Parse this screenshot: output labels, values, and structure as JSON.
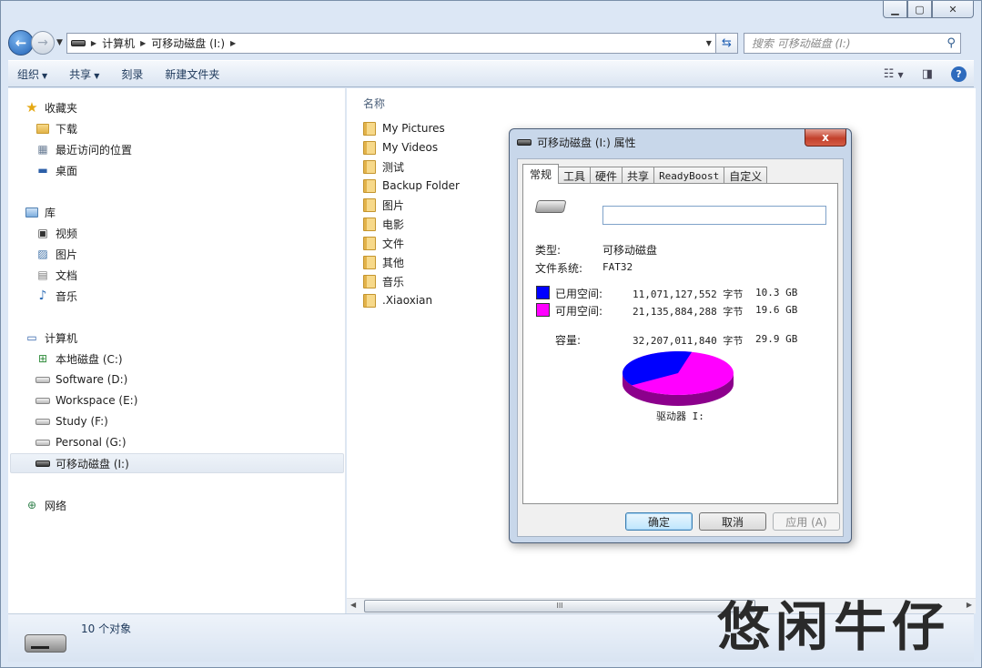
{
  "address": {
    "crumbs": [
      "计算机",
      "可移动磁盘 (I:)"
    ]
  },
  "search": {
    "placeholder": "搜索 可移动磁盘 (I:)"
  },
  "toolbar": {
    "organize": "组织",
    "share": "共享",
    "burn": "刻录",
    "new_folder": "新建文件夹"
  },
  "sidebar": {
    "favorites": {
      "label": "收藏夹",
      "items": [
        "下载",
        "最近访问的位置",
        "桌面"
      ]
    },
    "libraries": {
      "label": "库",
      "items": [
        "视频",
        "图片",
        "文档",
        "音乐"
      ]
    },
    "computer": {
      "label": "计算机",
      "items": [
        "本地磁盘 (C:)",
        "Software (D:)",
        "Workspace (E:)",
        "Study (F:)",
        "Personal (G:)",
        "可移动磁盘 (I:)"
      ]
    },
    "network": {
      "label": "网络"
    }
  },
  "content": {
    "column_header": "名称",
    "files": [
      "My Pictures",
      "My Videos",
      "测试",
      "Backup Folder",
      "图片",
      "电影",
      "文件",
      "其他",
      "音乐",
      ".Xiaoxian"
    ]
  },
  "status": {
    "text": "10 个对象"
  },
  "watermark": "悠闲牛仔",
  "dialog": {
    "title": "可移动磁盘 (I:) 属性",
    "close_glyph": "x",
    "tabs": [
      "常规",
      "工具",
      "硬件",
      "共享",
      "ReadyBoost",
      "自定义"
    ],
    "volume_label": "",
    "type_label": "类型:",
    "type_value": "可移动磁盘",
    "fs_label": "文件系统:",
    "fs_value": "FAT32",
    "used_label": "已用空间:",
    "used_bytes": "11,071,127,552 字节",
    "used_size": "10.3 GB",
    "free_label": "可用空间:",
    "free_bytes": "21,135,884,288 字节",
    "free_size": "19.6 GB",
    "capacity_label": "容量:",
    "capacity_bytes": "32,207,011,840 字节",
    "capacity_size": "29.9 GB",
    "drive_caption": "驱动器 I:",
    "used_fraction": 0.344,
    "used_color": "#0000ff",
    "free_color": "#ff00ff",
    "ok": "确定",
    "cancel": "取消",
    "apply": "应用 (A)"
  }
}
